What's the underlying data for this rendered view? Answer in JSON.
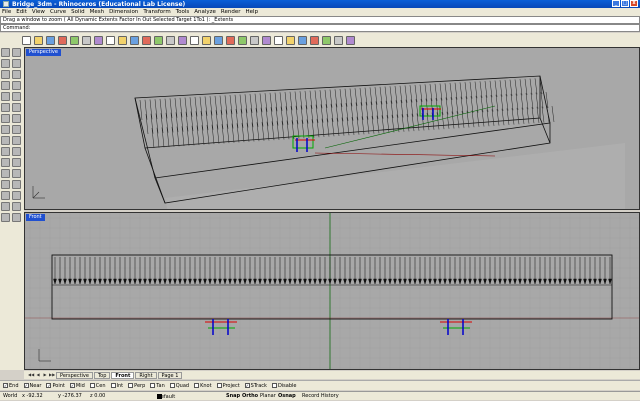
{
  "window": {
    "title": "Bridge_3dm - Rhinoceros (Educational Lab License)",
    "minimize": "_",
    "maximize": "□",
    "close": "x"
  },
  "menubar": [
    "File",
    "Edit",
    "View",
    "Curve",
    "Solid",
    "Mesh",
    "Dimension",
    "Transform",
    "Tools",
    "Analyze",
    "Render",
    "Help"
  ],
  "command": {
    "history": "Drag a window to zoom ( All Dynamic Extents Factor In Out Selected Target 1To1 ): _Extents",
    "prompt": "Command:"
  },
  "toolbar": {
    "icons": [
      "new-file-icon",
      "open-icon",
      "save-icon",
      "print-icon",
      "cut-icon",
      "copy-icon",
      "paste-icon",
      "undo-icon",
      "redo-icon",
      "pan-icon",
      "rotate-view-icon",
      "zoom-window-icon",
      "zoom-extents-icon",
      "zoom-selected-icon",
      "zoom-dynamic-icon",
      "zoom-all-icon",
      "select-icon",
      "grid-icon",
      "layers-icon",
      "properties-icon",
      "object-snap-icon",
      "lights-icon",
      "render-icon",
      "material-icon",
      "sphere-icon",
      "globe-icon",
      "options-icon",
      "help-icon"
    ]
  },
  "lefttools": {
    "icons": [
      "point-icon",
      "polyline-icon",
      "line-icon",
      "circle-icon",
      "arc-icon",
      "ellipse-icon",
      "rectangle-icon",
      "polygon-icon",
      "curve-icon",
      "freeform-icon",
      "surface-icon",
      "extrude-icon",
      "box-icon",
      "cylinder-icon",
      "sphere-solid-icon",
      "mesh-icon",
      "fillet-icon",
      "chamfer-icon",
      "offset-icon",
      "trim-icon",
      "split-icon",
      "join-icon",
      "explode-icon",
      "group-icon",
      "move-icon",
      "copy-obj-icon",
      "rotate-icon",
      "scale-icon",
      "mirror-icon",
      "array-icon",
      "text-icon",
      "dimension-icon"
    ]
  },
  "viewports": {
    "perspective": {
      "label": "Perspective"
    },
    "front": {
      "label": "Front"
    }
  },
  "tabs": [
    {
      "label": "Perspective",
      "active": false
    },
    {
      "label": "Top",
      "active": false
    },
    {
      "label": "Front",
      "active": true
    },
    {
      "label": "Right",
      "active": false
    },
    {
      "label": "Page 1",
      "active": false
    }
  ],
  "osnaps": [
    {
      "label": "End",
      "checked": true
    },
    {
      "label": "Near",
      "checked": true
    },
    {
      "label": "Point",
      "checked": true
    },
    {
      "label": "Mid",
      "checked": true
    },
    {
      "label": "Cen",
      "checked": false
    },
    {
      "label": "Int",
      "checked": false
    },
    {
      "label": "Perp",
      "checked": false
    },
    {
      "label": "Tan",
      "checked": false
    },
    {
      "label": "Quad",
      "checked": false
    },
    {
      "label": "Knot",
      "checked": false
    },
    {
      "label": "Project",
      "checked": false
    },
    {
      "label": "STrack",
      "checked": true
    },
    {
      "label": "Disable",
      "checked": false
    }
  ],
  "status": {
    "cplane": "World",
    "x": "x -92.32",
    "y": "y -276.37",
    "z": "z 0.00",
    "layer": "Default",
    "snap": "Snap",
    "ortho": "Ortho",
    "planar": "Planar",
    "osnap": "Osnap",
    "record": "Record History"
  },
  "colors": {
    "titlebar": "#0a5fd8",
    "viewport_bg": "#a8a8a8",
    "active_label": "#2050d0",
    "grid_line": "#9c9c9c",
    "x_axis": "#8b0000",
    "y_axis": "#006400"
  }
}
